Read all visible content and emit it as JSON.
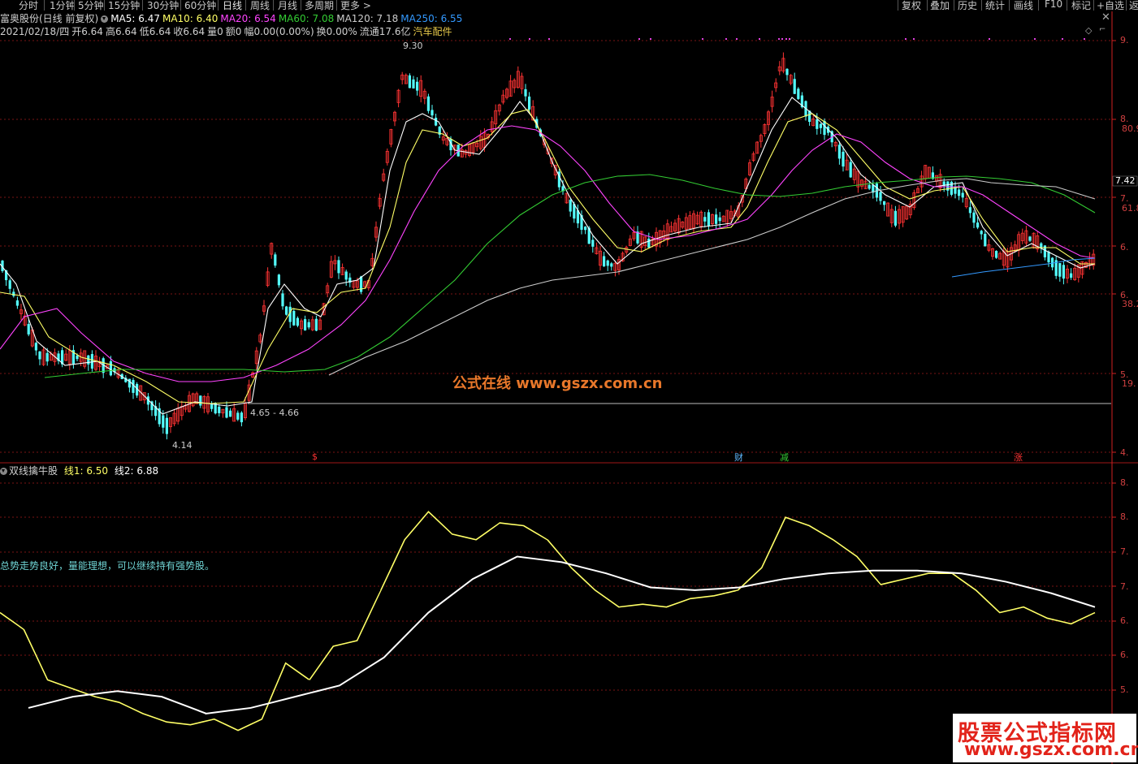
{
  "toolbar": {
    "periods": [
      "分时",
      "1分钟",
      "5分钟",
      "15分钟",
      "30分钟",
      "60分钟",
      "日线",
      "周线",
      "月线",
      "多周期",
      "更多 >"
    ],
    "right_tools": [
      "复权",
      "叠加",
      "历史",
      "统计",
      "画线",
      "F10",
      "标记",
      "+自选",
      "返"
    ]
  },
  "header": {
    "stock_label": "富奥股份(日线 前复权)",
    "ma5": "MA5: 6.47",
    "ma10": "MA10: 6.40",
    "ma20": "MA20: 6.54",
    "ma60": "MA60: 7.08",
    "ma120": "MA120: 7.18",
    "ma250": "MA250: 6.55",
    "date": "2021/02/18/四",
    "open": "开6.64",
    "high": "高6.64",
    "low": "低6.64",
    "close": "收6.64",
    "volume": "量0",
    "amount": "额0",
    "range": "幅0.00(0.00%)",
    "turnover": "换0.00%",
    "float": "流通17.6亿",
    "sector": "汽车配件"
  },
  "colors": {
    "ma5": "#ffffff",
    "ma10": "#ffff66",
    "ma20": "#ff44ff",
    "ma60": "#33cc33",
    "ma120": "#cccccc",
    "ma250": "#3399ff",
    "up": "#ff3333",
    "down": "#54ffff",
    "line1": "#ffff66",
    "line2": "#ffffff",
    "grid": "#7a1414",
    "axis": "#d02020"
  },
  "price_labels": {
    "high_mark": "9.30",
    "low_mark": "4.14",
    "support_mark": "4.65 - 4.66"
  },
  "right_axis": {
    "top": [
      "9.",
      "8.",
      "80.9",
      "7.42",
      "7.",
      "61.8",
      "6.",
      "6.",
      "38.2",
      "5.",
      "19.",
      "4."
    ],
    "bottom": [
      "8.",
      "8.",
      "7.",
      "7.",
      "6.",
      "6.",
      "5."
    ]
  },
  "events": [
    {
      "text": "$",
      "color": "#ff3333"
    },
    {
      "text": "财",
      "color": "#5fb8ff"
    },
    {
      "text": "减",
      "color": "#33cc33"
    },
    {
      "text": "涨",
      "color": "#ff3333"
    }
  ],
  "indicator": {
    "title": "双线擒牛股",
    "line1": "线1: 6.50",
    "line2": "线2: 6.88",
    "advice": "总势走势良好，量能理想，可以继续持有强势股。"
  },
  "watermarks": {
    "center": "公式在线  www.gszx.com.cn",
    "corner_cn": "股票公式指标网",
    "corner_url": "www.gszx.com.cn"
  },
  "chart_data": {
    "type": "line",
    "series": [
      {
        "name": "线1",
        "values": [
          6.8,
          6.5,
          5.6,
          5.45,
          5.3,
          5.2,
          5.0,
          4.85,
          4.8,
          4.9,
          4.7,
          4.9,
          5.9,
          5.6,
          6.2,
          6.3,
          7.2,
          8.1,
          8.6,
          8.2,
          8.1,
          8.4,
          8.35,
          8.1,
          7.6,
          7.2,
          6.9,
          6.95,
          6.9,
          7.05,
          7.1,
          7.2,
          7.6,
          8.5,
          8.35,
          8.1,
          7.8,
          7.3,
          7.4,
          7.5,
          7.5,
          7.2,
          6.8,
          6.9,
          6.7,
          6.6,
          6.8
        ]
      },
      {
        "name": "线2",
        "values": [
          5.1,
          5.3,
          5.4,
          5.3,
          5.0,
          5.1,
          5.3,
          5.5,
          6.0,
          6.8,
          7.4,
          7.8,
          7.7,
          7.5,
          7.25,
          7.2,
          7.25,
          7.4,
          7.5,
          7.55,
          7.55,
          7.5,
          7.35,
          7.15,
          6.9
        ]
      }
    ],
    "ylim": [
      4.1,
      9.4
    ]
  }
}
